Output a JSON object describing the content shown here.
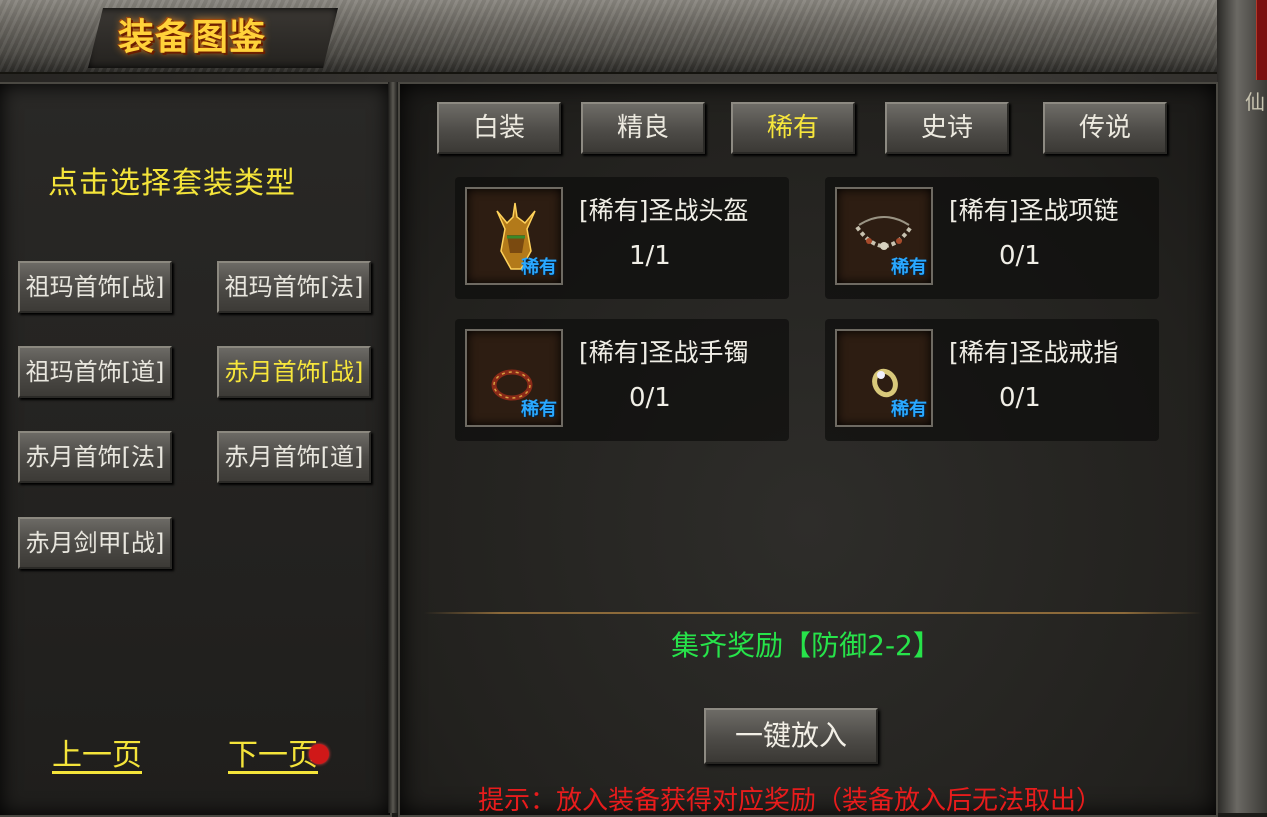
{
  "window": {
    "title": "装备图鉴"
  },
  "left": {
    "heading": "点击选择套装类型",
    "sets": [
      {
        "label": "祖玛首饰[战]",
        "active": false
      },
      {
        "label": "祖玛首饰[法]",
        "active": false
      },
      {
        "label": "祖玛首饰[道]",
        "active": false
      },
      {
        "label": "赤月首饰[战]",
        "active": true
      },
      {
        "label": "赤月首饰[法]",
        "active": false
      },
      {
        "label": "赤月首饰[道]",
        "active": false
      },
      {
        "label": "赤月剑甲[战]",
        "active": false
      }
    ],
    "prev_page": "上一页",
    "next_page": "下一页"
  },
  "tabs": [
    {
      "label": "白装",
      "active": false
    },
    {
      "label": "精良",
      "active": false
    },
    {
      "label": "稀有",
      "active": true
    },
    {
      "label": "史诗",
      "active": false
    },
    {
      "label": "传说",
      "active": false
    }
  ],
  "items": [
    {
      "name": "[稀有]圣战头盔",
      "count": "1/1",
      "tag": "稀有",
      "icon": "helmet-icon"
    },
    {
      "name": "[稀有]圣战项链",
      "count": "0/1",
      "tag": "稀有",
      "icon": "necklace-icon"
    },
    {
      "name": "[稀有]圣战手镯",
      "count": "0/1",
      "tag": "稀有",
      "icon": "bracelet-icon"
    },
    {
      "name": "[稀有]圣战戒指",
      "count": "0/1",
      "tag": "稀有",
      "icon": "ring-icon"
    }
  ],
  "reward": "集齐奖励【防御2-2】",
  "put_all_button": "一键放入",
  "hint": "提示：放入装备获得对应奖励（装备放入后无法取出）",
  "edge_glyph": "仙",
  "colors": {
    "highlight_yellow": "#f7e63b",
    "reward_green": "#27e34a",
    "hint_red": "#e81c1c",
    "rarity_blue": "#2aa8ff"
  }
}
